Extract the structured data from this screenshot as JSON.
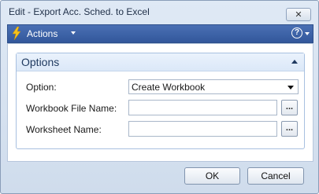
{
  "window": {
    "title": "Edit - Export Acc. Sched. to Excel"
  },
  "actionbar": {
    "actions_label": "Actions",
    "help_symbol": "?"
  },
  "fasttab": {
    "title": "Options"
  },
  "fields": {
    "option": {
      "label": "Option:",
      "value": "Create Workbook"
    },
    "workbook_file_name": {
      "label": "Workbook File Name:",
      "value": "",
      "button": "..."
    },
    "worksheet_name": {
      "label": "Worksheet Name:",
      "value": "",
      "button": "..."
    }
  },
  "buttons": {
    "ok": "OK",
    "cancel": "Cancel"
  },
  "colors": {
    "action_bar": "#3a5fa5",
    "fasttab_title": "#1f3a60"
  }
}
